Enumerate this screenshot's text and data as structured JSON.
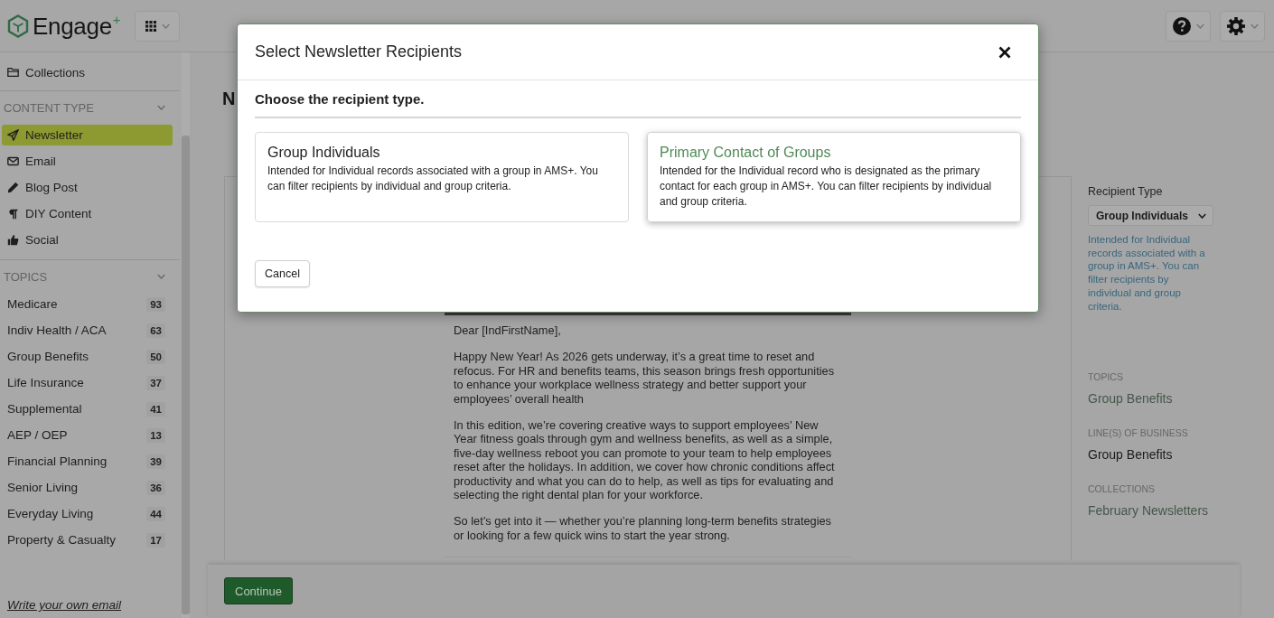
{
  "top_bar": {
    "logo": "Engage$^{+}$"
  },
  "sidebar": {
    "collections": "Collections",
    "sections": [
      {
        "title": "CONTENT TYPE",
        "kind": "type",
        "expanded": true,
        "items": [
          {
            "label": "Newsletter",
            "selected": true
          },
          {
            "label": "Email",
            "selected": false
          },
          {
            "label": "Blog Post",
            "selected": false
          },
          {
            "label": "DIY Content",
            "selected": false
          },
          {
            "label": "Social",
            "selected": false
          }
        ]
      },
      {
        "title": "TOPICS",
        "kind": "topic",
        "expanded": true,
        "items": [
          {
            "label": "Medicare",
            "count": "93",
            "selected": false
          },
          {
            "label": "Indiv Health / ACA",
            "count": "63",
            "selected": false
          },
          {
            "label": "Group Benefits",
            "count": "50",
            "selected": false
          },
          {
            "label": "Life Insurance",
            "count": "37",
            "selected": false
          },
          {
            "label": "Supplemental",
            "count": "41",
            "selected": false
          },
          {
            "label": "AEP / OEP",
            "count": "13",
            "selected": false
          },
          {
            "label": "Financial Planning",
            "count": "39",
            "selected": false
          },
          {
            "label": "Senior Living",
            "count": "36",
            "selected": false
          },
          {
            "label": "Everyday Living",
            "count": "44",
            "selected": false
          },
          {
            "label": "Property & Casualty",
            "count": "17",
            "selected": false
          }
        ]
      }
    ],
    "footer_link": "Write your own email"
  },
  "main": {
    "title": "N",
    "email": {
      "paragraphs": [
        "Dear [IndFirstName],",
        "Happy New Year! As 2026 gets underway, it’s a great time to reset and refocus. For HR and benefits teams, this season brings fresh opportunities to enhance your workplace wellness strategy and better support your employees’ overall health",
        "In this edition, we’re covering creative ways to support employees’ New Year fitness goals through gym and wellness benefits, as well as a simple, five-day wellness reboot you can promote to your team to help employees reset after the holidays. In addition, we cover how chronic conditions affect productivity and what you can do to help, as well as tips for evaluating and selecting the right dental plan for your workforce.",
        "So let’s get into it — whether you’re planning long-term benefits strategies or looking for a few quick wins to start the year strong."
      ]
    },
    "details": {
      "recipient_type": {
        "label": "Recipient Type",
        "value": "Group Individuals",
        "description": "Intended for Individual records associated with a group in AMS+. You can filter recipients by individual and group criteria."
      },
      "fields": [
        {
          "label": "TOPICS",
          "value": "Group Benefits",
          "kind": "link"
        },
        {
          "label": "LINE(S) OF BUSINESS",
          "value": "Group Benefits",
          "kind": "text"
        },
        {
          "label": "COLLECTIONS",
          "value": "February Newsletters",
          "kind": "link"
        }
      ]
    },
    "continue_button": "Continue"
  },
  "modal": {
    "title": "Select Newsletter Recipients",
    "prompt": "Choose the recipient type.",
    "options": [
      {
        "title": "Group Individuals",
        "description": "Intended for Individual records associated with a group in AMS+. You can filter recipients by individual and group criteria.",
        "selected": false
      },
      {
        "title": "Primary Contact of Groups",
        "description": "Intended for the Individual record who is designated as the primary contact for each group in AMS+. You can filter recipients by individual and group criteria.",
        "selected": true
      }
    ],
    "cancel_button": "Cancel"
  }
}
